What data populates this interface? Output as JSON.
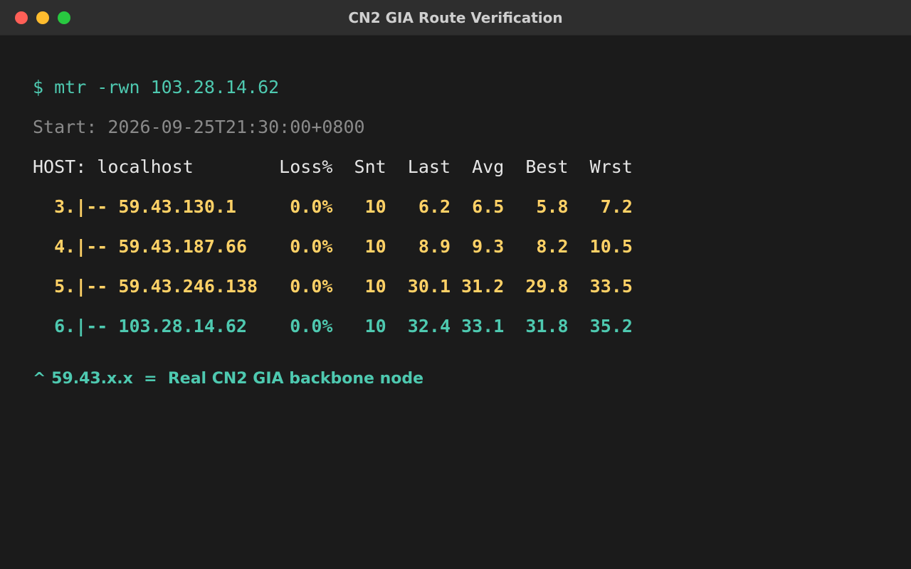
{
  "window": {
    "title": "CN2 GIA Route Verification"
  },
  "terminal": {
    "command": "$ mtr -rwn 103.28.14.62",
    "start": "Start: 2026-09-25T21:30:00+0800",
    "header": "HOST: localhost        Loss%  Snt  Last  Avg  Best  Wrst",
    "hops": [
      {
        "line": "  3.|-- 59.43.130.1     0.0%   10   6.2  6.5   5.8   7.2",
        "color": "#ffd166"
      },
      {
        "line": "  4.|-- 59.43.187.66    0.0%   10   8.9  9.3   8.2  10.5",
        "color": "#ffd166"
      },
      {
        "line": "  5.|-- 59.43.246.138   0.0%   10  30.1 31.2  29.8  33.5",
        "color": "#ffd166"
      },
      {
        "line": "  6.|-- 103.28.14.62    0.0%   10  32.4 33.1  31.8  35.2",
        "color": "#4ec9b0"
      }
    ],
    "note": "^ 59.43.x.x  =  Real CN2 GIA backbone node"
  },
  "colors": {
    "background": "#1b1b1b",
    "titlebar": "#2e2e2e",
    "command": "#4ec9b0",
    "cn2_hop": "#ffd166",
    "destination_hop": "#4ec9b0",
    "muted": "#8a8a8a"
  }
}
